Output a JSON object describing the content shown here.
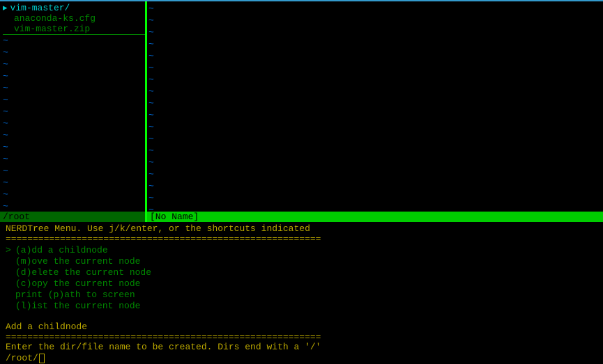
{
  "nerdtree": {
    "root_dir": "vim-master/",
    "files": [
      "anaconda-ks.cfg",
      "vim-master.zip"
    ],
    "tilde_count": 15
  },
  "editor": {
    "tilde_count": 18
  },
  "status": {
    "left": "/root",
    "right": "[No Name]"
  },
  "menu": {
    "header": "NERDTree Menu. Use j/k/enter, or the shortcuts indicated",
    "divider": "==========================================================",
    "items": [
      {
        "indicator": "> ",
        "label": "(a)dd a childnode"
      },
      {
        "indicator": "  ",
        "label": "(m)ove the current node"
      },
      {
        "indicator": "  ",
        "label": "(d)elete the current node"
      },
      {
        "indicator": "  ",
        "label": "(c)opy the current node"
      },
      {
        "indicator": "  ",
        "label": "print (p)ath to screen"
      },
      {
        "indicator": "  ",
        "label": "(l)ist the current node"
      }
    ]
  },
  "prompt": {
    "title": "Add a childnode",
    "divider": "==========================================================",
    "text": "Enter the dir/file name to be created. Dirs end with a '/'",
    "input_prefix": "/root/"
  }
}
